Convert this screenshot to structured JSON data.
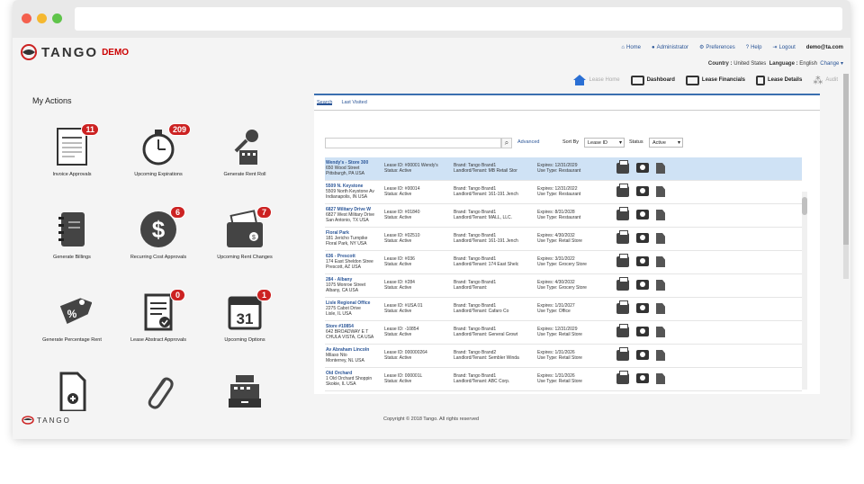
{
  "app": {
    "name": "TANGO",
    "demo": "DEMO"
  },
  "topnav": [
    "Home",
    "Administrator",
    "Preferences",
    "Help",
    "Logout"
  ],
  "user": "demo@ta.com",
  "country": {
    "label": "Country :",
    "value": "United States",
    "lang_label": "Language :",
    "lang_value": "English",
    "change": "Change ▾"
  },
  "tabs": [
    {
      "label": "Lease Home",
      "muted": true,
      "icon": "home-icon"
    },
    {
      "label": "Dashboard",
      "muted": false,
      "icon": "gauge-icon"
    },
    {
      "label": "Lease Financials",
      "muted": false,
      "icon": "money-icon"
    },
    {
      "label": "Lease Details",
      "muted": false,
      "icon": "document-icon"
    },
    {
      "label": "Audit",
      "muted": true,
      "icon": "footprints-icon"
    }
  ],
  "my_actions": "My Actions",
  "actions": [
    {
      "label": "Invoice Approvals",
      "badge": "11",
      "icon": "invoice-icon"
    },
    {
      "label": "Upcoming Expirations",
      "badge": "209",
      "icon": "stopwatch-icon"
    },
    {
      "label": "Generate Rent Roll",
      "badge": "",
      "icon": "key-building-icon"
    },
    {
      "label": "Generate Billings",
      "badge": "",
      "icon": "notebook-icon"
    },
    {
      "label": "Recurring Cost Approvals",
      "badge": "6",
      "icon": "dollar-icon"
    },
    {
      "label": "Upcoming Rent Changes",
      "badge": "7",
      "icon": "wallet-icon"
    },
    {
      "label": "Generate Percentage Rent",
      "badge": "",
      "icon": "percent-tag-icon"
    },
    {
      "label": "Lease Abstract Approvals",
      "badge": "0",
      "icon": "checklist-icon"
    },
    {
      "label": "Upcoming Options",
      "badge": "1",
      "icon": "calendar-icon"
    },
    {
      "label": "",
      "badge": "",
      "icon": "add-document-icon"
    },
    {
      "label": "",
      "badge": "",
      "icon": "paperclip-icon"
    },
    {
      "label": "",
      "badge": "",
      "icon": "cash-register-icon"
    }
  ],
  "calendar_day": "31",
  "panel": {
    "tabs": [
      "Search",
      "Last Visited"
    ],
    "advanced": "Advanced",
    "sort_by_label": "Sort By",
    "sort_by_value": "Lease ID",
    "status_label": "Status",
    "status_value": "Active"
  },
  "rows": [
    {
      "name": "Wendy's - Store 300",
      "addr1": "650 Wood Street",
      "addr2": "Pittsburgh, PA USA",
      "lease_id": "Lease ID: #00001 Wendy's",
      "status": "Status:  Active",
      "brand": "Brand:  Tango Brand1",
      "landlord": "Landlord/Tenant:  MB Retail Stor",
      "expires": "Expires:  12/31/2029",
      "use": "Use Type:  Restaurant",
      "hl": true
    },
    {
      "name": "5509 N. Keystone",
      "addr1": "5509 North Keystone Av",
      "addr2": "Indianapolis, IN USA",
      "lease_id": "Lease ID:  #00014",
      "status": "Status:  Active",
      "brand": "Brand:  Tango Brand1",
      "landlord": "Landlord/Tenant:  161-191 Jench",
      "expires": "Expires:  12/31/2022",
      "use": "Use Type:  Restaurant",
      "hl": false
    },
    {
      "name": "6827 Military Drive W",
      "addr1": "6827 West Military Drive",
      "addr2": "San Antonio, TX USA",
      "lease_id": "Lease ID:  #01840",
      "status": "Status:  Active",
      "brand": "Brand:  Tango Brand1",
      "landlord": "Landlord/Tenant:  MALL, LLC.",
      "expires": "Expires:  8/31/2028",
      "use": "Use Type:  Restaurant",
      "hl": false
    },
    {
      "name": "Floral Park",
      "addr1": "181 Jericho Turnpike",
      "addr2": "Floral Park, NY USA",
      "lease_id": "Lease ID:  #02510",
      "status": "Status:  Active",
      "brand": "Brand:  Tango Brand1",
      "landlord": "Landlord/Tenant:  161-191 Jench",
      "expires": "Expires:  4/30/2032",
      "use": "Use Type:  Retail Store",
      "hl": false
    },
    {
      "name": "636 - Prescott",
      "addr1": "174 East Sheldon Stree",
      "addr2": "Prescott, AZ USA",
      "lease_id": "Lease ID:  #036",
      "status": "Status:  Active",
      "brand": "Brand:  Tango Brand1",
      "landlord": "Landlord/Tenant:  174 East Shelc",
      "expires": "Expires:  3/31/2022",
      "use": "Use Type:  Grocery Store",
      "hl": false
    },
    {
      "name": "284 - Albany",
      "addr1": "1075 Monroe Street",
      "addr2": "Albany, CA USA",
      "lease_id": "Lease ID:  #284",
      "status": "Status:  Active",
      "brand": "Brand:  Tango Brand1",
      "landlord": "Landlord/Tenant:",
      "expires": "Expires:  4/30/2032",
      "use": "Use Type:  Grocery Store",
      "hl": false
    },
    {
      "name": "Lisle Regional Office",
      "addr1": "2275 Cabot Drive",
      "addr2": "Lisle, IL USA",
      "lease_id": "Lease ID:  #USA 01",
      "status": "Status:  Active",
      "brand": "Brand:  Tango Brand1",
      "landlord": "Landlord/Tenant:  Cafaro Co",
      "expires": "Expires:  1/31/2027",
      "use": "Use Type:  Office",
      "hl": false
    },
    {
      "name": "Store #10854",
      "addr1": "642 BROADWAY E T",
      "addr2": "CHULA VISTA, CA USA",
      "lease_id": "Lease ID:  -10854",
      "status": "Status:  Active",
      "brand": "Brand:  Tango Brand1",
      "landlord": "Landlord/Tenant:  General Growt",
      "expires": "Expires:  12/31/2029",
      "use": "Use Type:  Retail Store",
      "hl": false
    },
    {
      "name": "Av Abraham Lincoln",
      "addr1": "Milaso Nto",
      "addr2": "Monterrey, NL USA",
      "lease_id": "Lease ID:  000000264",
      "status": "Status:  Active",
      "brand": "Brand:  Tango Brand2",
      "landlord": "Landlord/Tenant:  Sembler Winda",
      "expires": "Expires:  1/31/2026",
      "use": "Use Type:  Retail Store",
      "hl": false
    },
    {
      "name": "Old Orchard",
      "addr1": "1 Old Orchard Shoppin",
      "addr2": "Skokie, IL USA",
      "lease_id": "Lease ID:  000001L",
      "status": "Status:  Active",
      "brand": "Brand:  Tango Brand1",
      "landlord": "Landlord/Tenant:  ABC Corp.",
      "expires": "Expires:  1/31/2026",
      "use": "Use Type:  Retail Store",
      "hl": false
    }
  ],
  "bottom_logo": "TANGO",
  "copyright": "Copyright © 2018 Tango. All rights reserved"
}
